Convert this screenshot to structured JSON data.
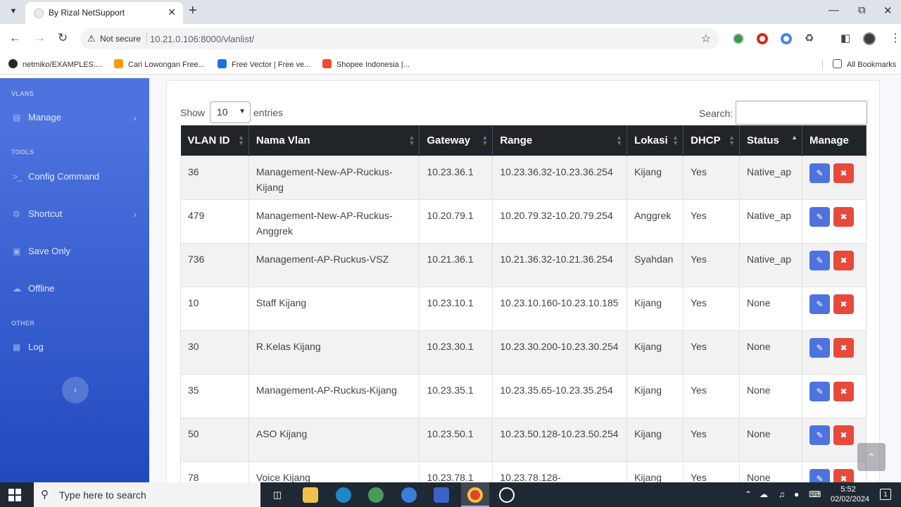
{
  "browser": {
    "tab_title": "By Rizal NetSupport",
    "not_secure": "Not secure",
    "url": "10.21.0.106:8000/vlanlist/",
    "bookmarks": [
      {
        "label": "netmiko/EXAMPLES....",
        "icon": "github-icon"
      },
      {
        "label": "Cari Lowongan Free...",
        "icon": "briefcase-icon"
      },
      {
        "label": "Free Vector | Free ve...",
        "icon": "vector-icon"
      },
      {
        "label": "Shopee Indonesia |...",
        "icon": "shopee-icon"
      }
    ],
    "all_bookmarks": "All Bookmarks"
  },
  "sidebar": {
    "heading_vlans": "VLANS",
    "heading_tools": "TOOLS",
    "heading_other": "OTHER",
    "manage": "Manage",
    "config_command": "Config Command",
    "shortcut": "Shortcut",
    "save_only": "Save Only",
    "offline": "Offline",
    "log": "Log"
  },
  "table_controls": {
    "show_label": "Show",
    "page_size": "10",
    "entries_label": "entries",
    "search_label": "Search:"
  },
  "table": {
    "headers": [
      "VLAN ID",
      "Nama Vlan",
      "Gateway",
      "Range",
      "Lokasi",
      "DHCP",
      "Status",
      "Manage"
    ],
    "rows": [
      [
        "36",
        "Management-New-AP-Ruckus-Kijang",
        "10.23.36.1",
        "10.23.36.32-10.23.36.254",
        "Kijang",
        "Yes",
        "Native_ap"
      ],
      [
        "479",
        "Management-New-AP-Ruckus-Anggrek",
        "10.20.79.1",
        "10.20.79.32-10.20.79.254",
        "Anggrek",
        "Yes",
        "Native_ap"
      ],
      [
        "736",
        "Management-AP-Ruckus-VSZ",
        "10.21.36.1",
        "10.21.36.32-10.21.36.254",
        "Syahdan",
        "Yes",
        "Native_ap"
      ],
      [
        "10",
        "Staff Kijang",
        "10.23.10.1",
        "10.23.10.160-10.23.10.185",
        "Kijang",
        "Yes",
        "None"
      ],
      [
        "30",
        "R.Kelas Kijang",
        "10.23.30.1",
        "10.23.30.200-10.23.30.254",
        "Kijang",
        "Yes",
        "None"
      ],
      [
        "35",
        "Management-AP-Ruckus-Kijang",
        "10.23.35.1",
        "10.23.35.65-10.23.35.254",
        "Kijang",
        "Yes",
        "None"
      ],
      [
        "50",
        "ASO Kijang",
        "10.23.50.1",
        "10.23.50.128-10.23.50.254",
        "Kijang",
        "Yes",
        "None"
      ],
      [
        "78",
        "Voice Kijang",
        "10.23.78.1",
        "10.23.78.128-",
        "Kijang",
        "Yes",
        "None"
      ]
    ]
  },
  "taskbar": {
    "search_placeholder": "Type here to search",
    "time": "5:52",
    "date": "02/02/2024"
  }
}
